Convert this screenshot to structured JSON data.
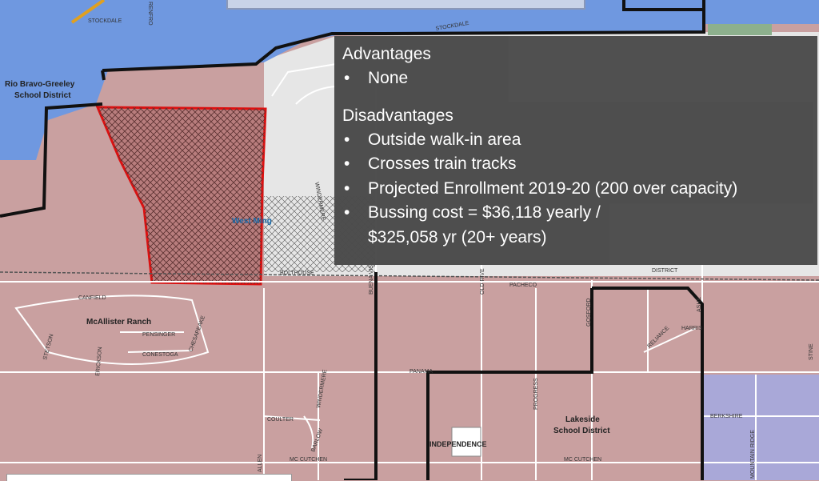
{
  "info_panel": {
    "advantages_title": "Advantages",
    "advantages": [
      "None"
    ],
    "disadvantages_title": "Disadvantages",
    "disadvantages": [
      "Outside walk-in area",
      "Crosses train tracks",
      "Projected Enrollment 2019-20 (200 over capacity)",
      "Bussing cost = $36,118 yearly /",
      "$325,058 yr (20+ years)"
    ]
  },
  "map_labels": {
    "rio_bravo": [
      "Rio Bravo-Greeley",
      "School District"
    ],
    "west_ming": "West Ming",
    "mcallister_ranch": "McAllister Ranch",
    "lakeside": [
      "Lakeside",
      "School District"
    ],
    "independence": "INDEPENDENCE",
    "stockdale_1": "STOCKDALE",
    "stockdale_2": "STOCKDALE",
    "canfield": "CANFIELD",
    "pensinger": "PENSINGER",
    "conestoga": "CONESTOGA",
    "chesapeake": "CHESAPEAKE",
    "stetson": "STETSON",
    "erickson": "ERICKSON",
    "bolthouse": "BOLTHOUSE",
    "buena_vista": "BUENA VIS",
    "old_river": "OLD RIVE",
    "pacheco": "PACHECO",
    "district": "DISTRICT",
    "gosford": "GOSFORD",
    "ashe": "ASHE",
    "reliance": "RELIANCE",
    "harris": "HARRIS",
    "panama": "PANAMA",
    "progress": "PROGRESS",
    "coulter": "COULTER",
    "windermere_s": "WINDERMERE",
    "barlow": "BARLOW",
    "allen": "ALLEN",
    "mc_cutchen_1": "MC CUTCHEN",
    "mc_cutchen_2": "MC CUTCHEN",
    "berkshire": "BERKSHIRE",
    "stine": "STINE",
    "mountain_ridge": "MOUNTAIN RIDGE",
    "windermere_n": "WINDERMERE",
    "renfro": "RENFRO"
  },
  "colors": {
    "rio_bravo_district": "#6f98e0",
    "lakeside_district": "#c9a0a0",
    "east_district": "#a9a8d8",
    "unassigned": "#e9e9e9",
    "proposed_area_outline": "#dd1111",
    "panel_background": "#4a4a4a"
  }
}
